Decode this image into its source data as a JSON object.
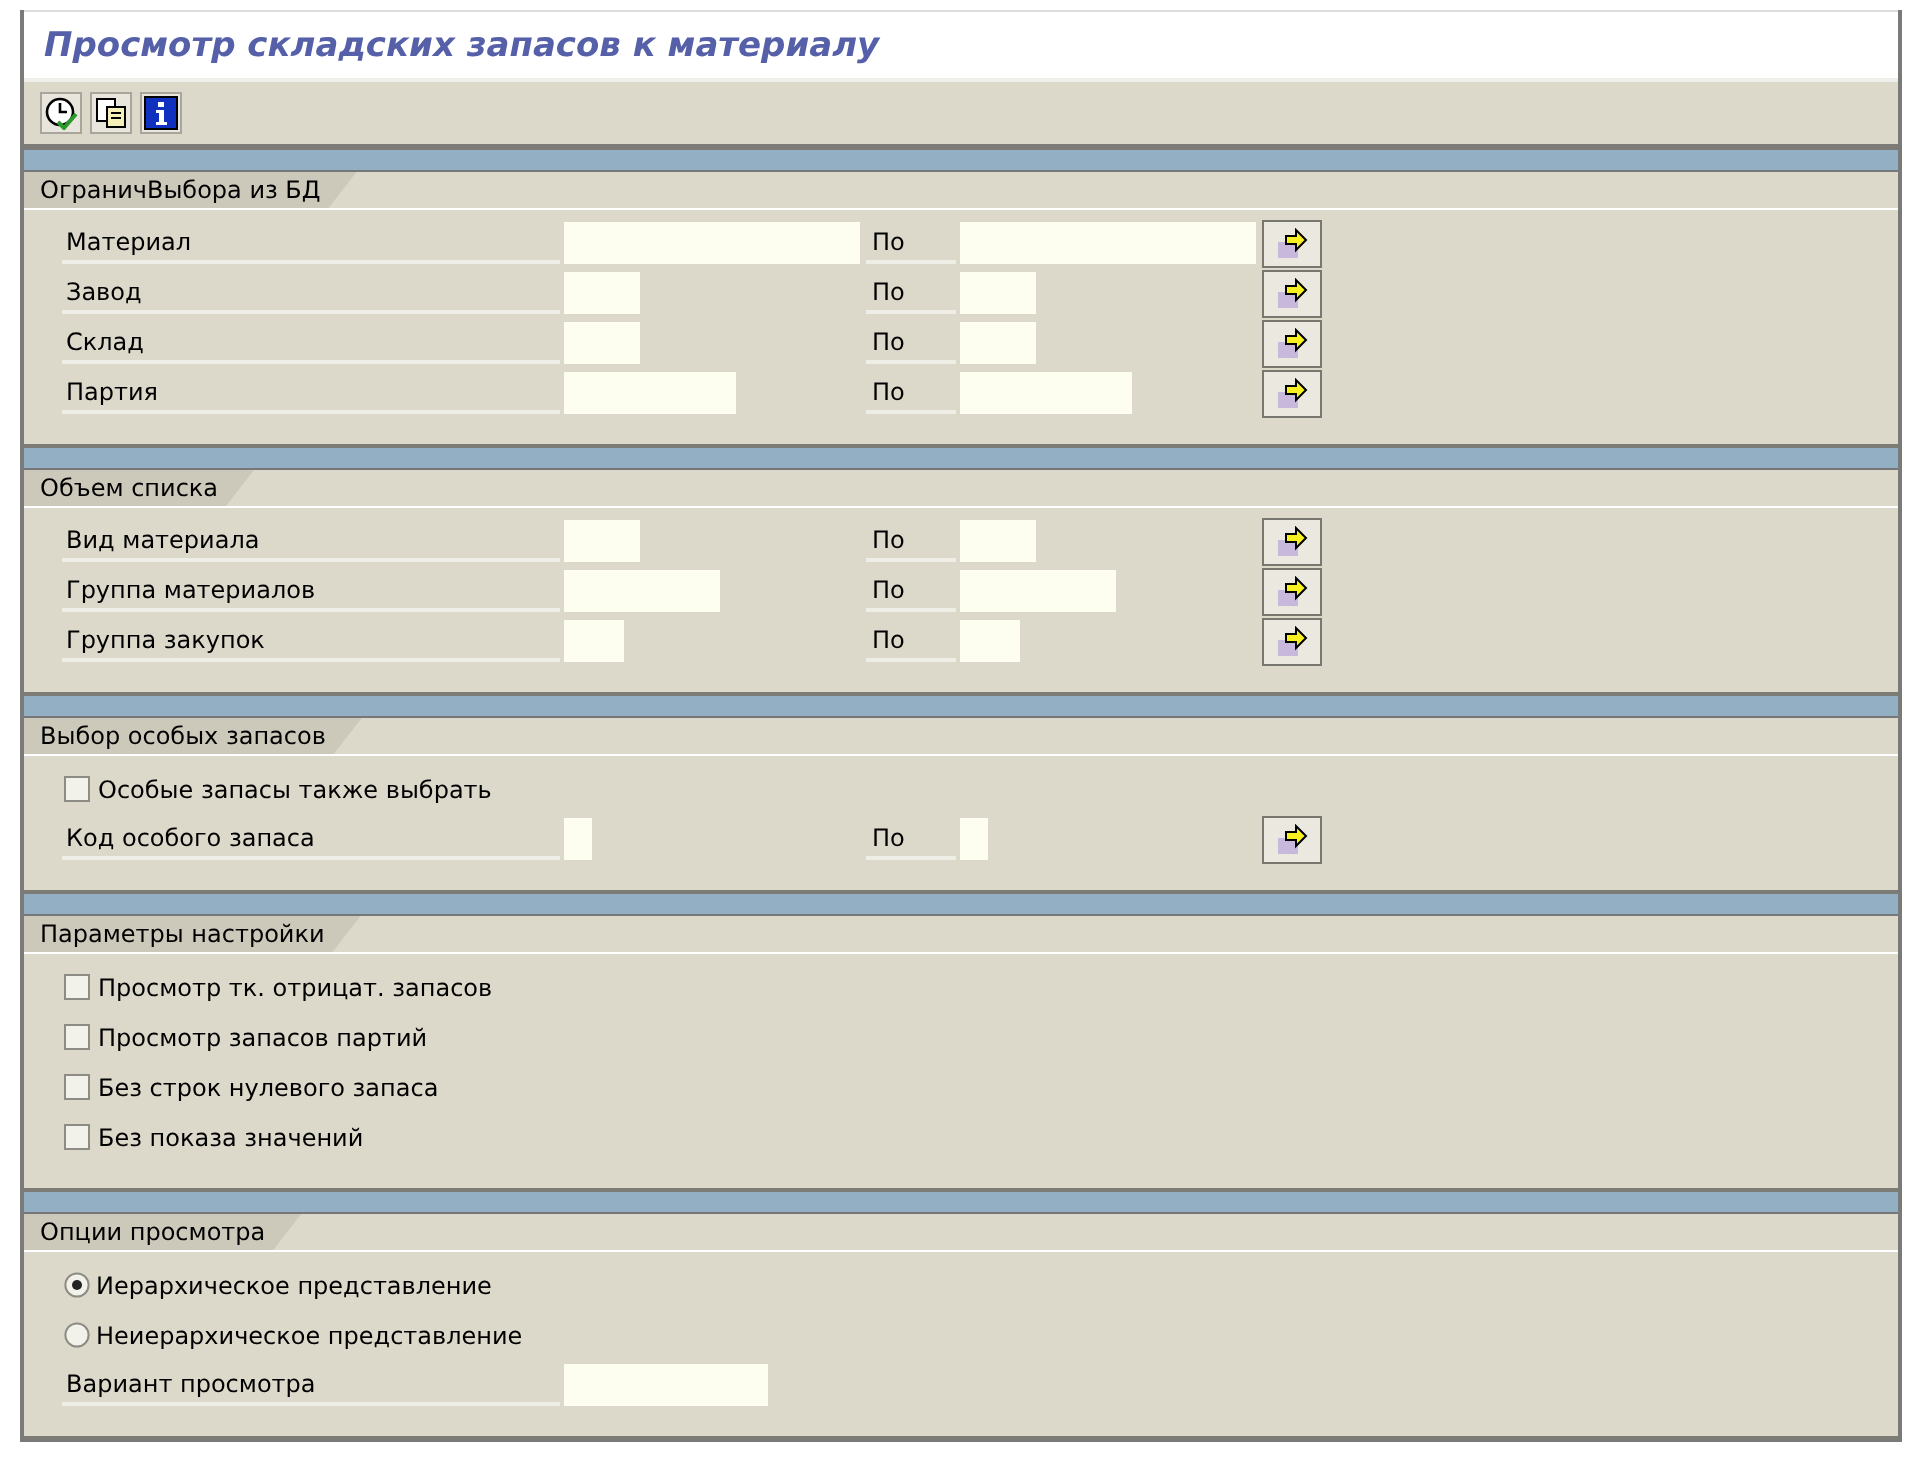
{
  "window": {
    "title": "Просмотр складских запасов к материалу"
  },
  "toolbar": [
    {
      "kind": "execute"
    },
    {
      "kind": "copy"
    },
    {
      "kind": "info"
    }
  ],
  "sections": [
    {
      "title": "ОграничВыбора из БД",
      "rows": [
        {
          "kind": "range",
          "label": "Материал",
          "to_label": "По"
        },
        {
          "kind": "range",
          "label": "Завод",
          "to_label": "По"
        },
        {
          "kind": "range",
          "label": "Склад",
          "to_label": "По"
        },
        {
          "kind": "range",
          "label": "Партия",
          "to_label": "По"
        }
      ]
    },
    {
      "title": "Объем списка",
      "rows": [
        {
          "kind": "range",
          "label": "Вид материала",
          "to_label": "По"
        },
        {
          "kind": "range",
          "label": "Группа материалов",
          "to_label": "По"
        },
        {
          "kind": "range",
          "label": "Группа закупок",
          "to_label": "По"
        }
      ]
    },
    {
      "title": "Выбор особых запасов",
      "rows": [
        {
          "kind": "checkbox",
          "label": "Особые запасы также выбрать",
          "checked": false
        },
        {
          "kind": "range",
          "label": "Код особого запаса",
          "to_label": "По"
        }
      ]
    },
    {
      "title": "Параметры настройки",
      "rows": [
        {
          "kind": "checkbox",
          "label": "Просмотр тк. отрицат. запасов",
          "checked": false
        },
        {
          "kind": "checkbox",
          "label": "Просмотр запасов партий",
          "checked": false
        },
        {
          "kind": "checkbox",
          "label": "Без строк нулевого запаса",
          "checked": false
        },
        {
          "kind": "checkbox",
          "label": "Без показа значений",
          "checked": false
        }
      ]
    },
    {
      "title": "Опции просмотра",
      "rows": [
        {
          "kind": "radio",
          "label": "Иерархическое представление",
          "selected": true
        },
        {
          "kind": "radio",
          "label": "Неиерархическое представление",
          "selected": false
        },
        {
          "kind": "field",
          "label": "Вариант просмотра"
        }
      ]
    }
  ]
}
